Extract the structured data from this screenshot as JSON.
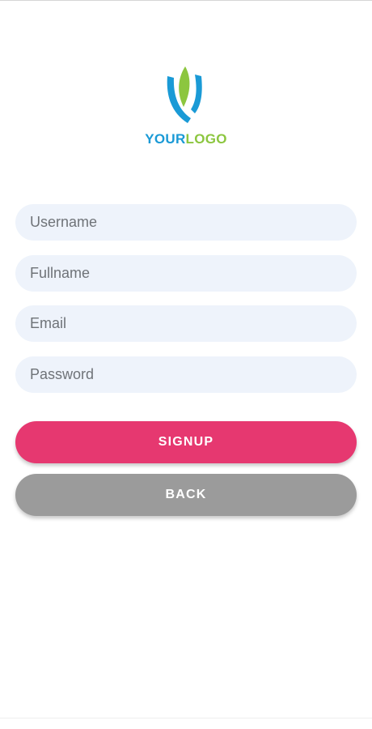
{
  "logo": {
    "part1": "YOUR",
    "part2": "LOGO",
    "colors": {
      "blue": "#1a9ad6",
      "green": "#8cc63f"
    },
    "icon": "shield-leaf-icon"
  },
  "form": {
    "username_placeholder": "Username",
    "fullname_placeholder": "Fullname",
    "email_placeholder": "Email",
    "password_placeholder": "Password"
  },
  "buttons": {
    "signup_label": "SIGNUP",
    "back_label": "BACK"
  },
  "colors": {
    "field_background": "#eef3fb",
    "signup_background": "#e63870",
    "back_background": "#9b9b9b"
  }
}
